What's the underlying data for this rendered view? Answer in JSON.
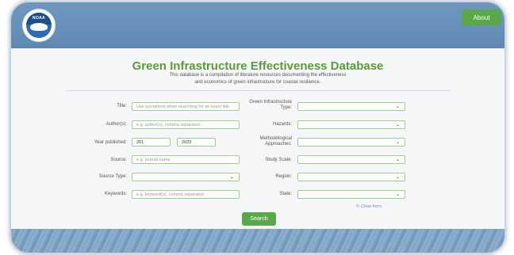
{
  "header": {
    "logo_text": "NOAA",
    "about_label": "About"
  },
  "intro": {
    "title": "Green Infrastructure Effectiveness Database",
    "subtitle_line1": "This database is a compilation of literature resources documenting the effectiveness",
    "subtitle_line2": "and economics of green infrastructure for coastal resilience."
  },
  "form": {
    "title_label": "Title:",
    "title_placeholder": "Use quotations when searching for an exact title.",
    "authors_label": "Author(s):",
    "authors_placeholder": "e.g. author(s), comma separated",
    "year_label": "Year published:",
    "year_from": "201",
    "year_to": "2023",
    "source_label": "Source:",
    "source_placeholder": "e.g. journal name",
    "source_type_label": "Source Type:",
    "keywords_label": "Keywords:",
    "keywords_placeholder": "e.g. keyword(s), comma separated",
    "gi_type_label_line1": "Green Infrastructure",
    "gi_type_label_line2": "Type:",
    "hazards_label": "Hazards:",
    "methods_label_line1": "Methodological",
    "methods_label_line2": "Approaches:",
    "study_scale_label": "Study Scale:",
    "region_label": "Region:",
    "state_label": "State:",
    "clear_label": "Clear form",
    "search_label": "Search"
  },
  "colors": {
    "brand_green": "#5ba84a",
    "header_blue": "#6690b8",
    "title_green": "#5a9a3e"
  },
  "icons": {
    "select_chevron": "chevron-down-icon",
    "clear": "refresh-icon"
  }
}
